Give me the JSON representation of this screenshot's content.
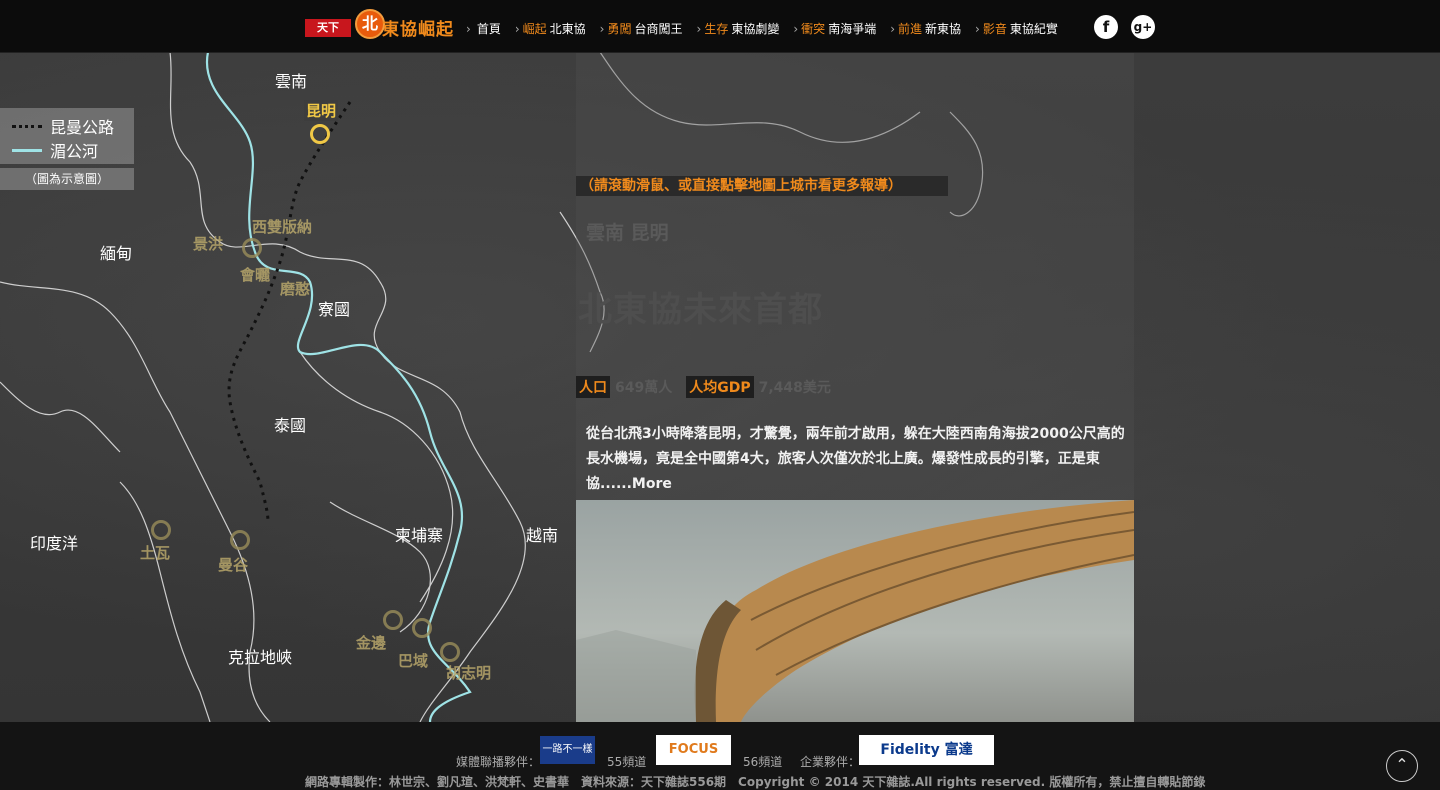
{
  "header": {
    "logo_cw": "天下",
    "logo_bei": "北",
    "logo_title": "東協崛起",
    "nav": [
      {
        "accent": "",
        "label": "首頁"
      },
      {
        "accent": "崛起",
        "label": "北東協"
      },
      {
        "accent": "勇闖",
        "label": "台商闖王"
      },
      {
        "accent": "生存",
        "label": "東協劇變"
      },
      {
        "accent": "衝突",
        "label": "南海爭端"
      },
      {
        "accent": "前進",
        "label": "新東協"
      },
      {
        "accent": "影音",
        "label": "東協紀實"
      }
    ],
    "social": {
      "facebook": "f",
      "googleplus": "g+"
    }
  },
  "legend": {
    "road": "昆曼公路",
    "river": "湄公河",
    "note": "（圖為示意圖）"
  },
  "map": {
    "regions": [
      "雲南",
      "緬甸",
      "寮國",
      "泰國",
      "印度洋",
      "柬埔寨",
      "越南",
      "克拉地峽"
    ],
    "cities": [
      "昆明",
      "西雙版納",
      "景洪",
      "會曬",
      "磨憨",
      "土瓦",
      "曼谷",
      "金邊",
      "巴域",
      "胡志明"
    ]
  },
  "panel": {
    "hint": "（請滾動滑鼠、或直接點擊地圖上城市看更多報導）",
    "region": "雲南 昆明",
    "headline": "北東協未來首都",
    "population_label": "人口",
    "population_value": "649萬人",
    "gdp_label": "人均GDP",
    "gdp_value": "7,448美元",
    "body": "從台北飛3小時降落昆明，才驚覺，兩年前才啟用，躲在大陸西南角海拔2000公尺高的長水機場，竟是全中國第4大，旅客人次僅次於北上廣。爆發性成長的引擎，正是東協......More"
  },
  "footer": {
    "media_label": "媒體聯播夥伴：",
    "channel1": "55頻道",
    "channel2": "56頻道",
    "corp_label": "企業夥伴：",
    "badge_news": "一路不一樣",
    "badge_focus": "FOCUS",
    "badge_fidelity": "Fidelity 富達",
    "copyright": "網路專輯製作：林世宗、劉凡瑄、洪梵軒、史書華　資料來源：天下雜誌556期　Copyright © 2014 天下雜誌.All rights reserved. 版權所有，禁止擅自轉貼節錄"
  }
}
